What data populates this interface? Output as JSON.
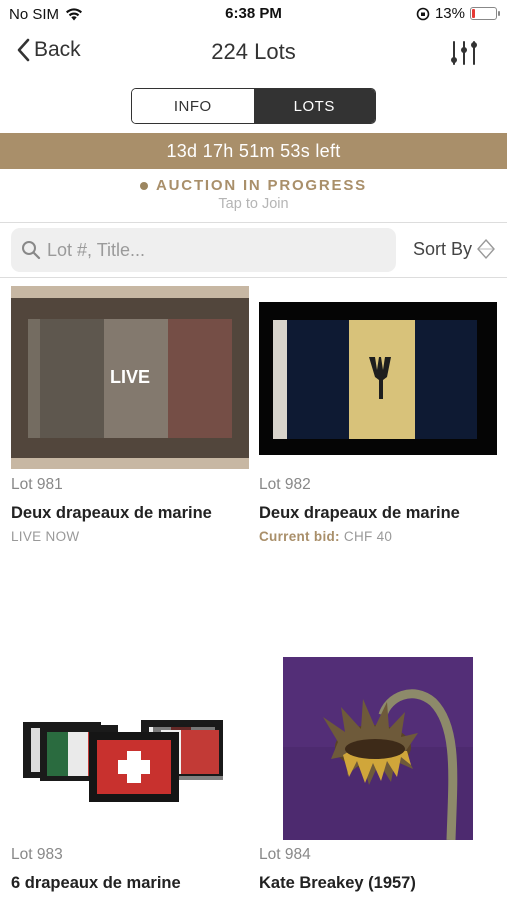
{
  "status_bar": {
    "carrier": "No SIM",
    "time": "6:38 PM",
    "battery_percent_text": "13%",
    "battery_level": 0.13
  },
  "nav": {
    "back_label": "Back",
    "title": "224 Lots"
  },
  "segments": {
    "info": "INFO",
    "lots": "LOTS",
    "selected": "LOTS"
  },
  "countdown": "13d 17h 51m 53s left",
  "auction": {
    "status": "AUCTION IN PROGRESS",
    "cta": "Tap to Join"
  },
  "search": {
    "placeholder": "Lot #, Title...",
    "value": ""
  },
  "sort_label": "Sort By",
  "lots": [
    {
      "number": "Lot 981",
      "title": "Deux drapeaux de marine",
      "status": "LIVE NOW",
      "badge": "LIVE"
    },
    {
      "number": "Lot 982",
      "title": "Deux drapeaux de marine",
      "bid_label": "Current bid:",
      "bid_value": "CHF 40"
    },
    {
      "number": "Lot 983",
      "title": "6 drapeaux de marine"
    },
    {
      "number": "Lot 984",
      "title": "Kate Breakey (1957)"
    }
  ],
  "colors": {
    "accent": "#a98f6a",
    "segment_active": "#333333",
    "battery_low": "#e53935"
  }
}
